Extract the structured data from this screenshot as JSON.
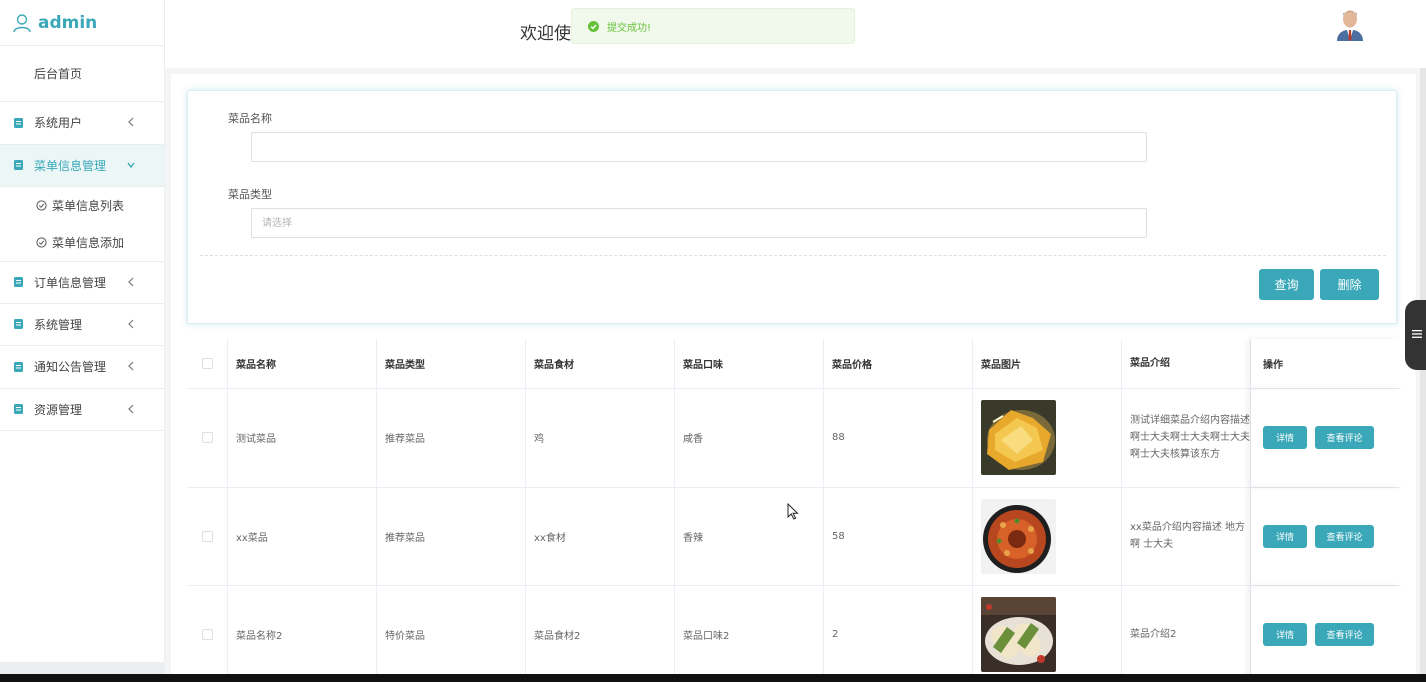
{
  "brand": {
    "title": "admin"
  },
  "sidebar": {
    "home": "后台首页",
    "items": [
      {
        "label": "系统用户"
      },
      {
        "label": "菜单信息管理"
      },
      {
        "label": "订单信息管理"
      },
      {
        "label": "系统管理"
      },
      {
        "label": "通知公告管理"
      },
      {
        "label": "资源管理"
      }
    ],
    "submenu": [
      {
        "label": "菜单信息列表"
      },
      {
        "label": "菜单信息添加"
      }
    ]
  },
  "header": {
    "welcome": "欢迎使"
  },
  "toast": {
    "message": "提交成功!"
  },
  "search": {
    "name_label": "菜品名称",
    "name_value": "",
    "type_label": "菜品类型",
    "type_placeholder": "请选择",
    "query_button": "查询",
    "delete_button": "删除"
  },
  "table": {
    "headers": [
      "菜品名称",
      "菜品类型",
      "菜品食材",
      "菜品口味",
      "菜品价格",
      "菜品图片",
      "菜品介绍",
      "操作"
    ],
    "rows": [
      {
        "name": "测试菜品",
        "type": "推荐菜品",
        "ingredient": "鸡",
        "taste": "咸香",
        "price": "88",
        "intro": "测试详细菜品介绍内容描述 啊士大夫啊士大夫啊士大夫 啊士大夫核算该东方"
      },
      {
        "name": "xx菜品",
        "type": "推荐菜品",
        "ingredient": "xx食材",
        "taste": "香辣",
        "price": "58",
        "intro": "xx菜品介绍内容描述 地方啊 士大夫"
      },
      {
        "name": "菜品名称2",
        "type": "特价菜品",
        "ingredient": "菜品食材2",
        "taste": "菜品口味2",
        "price": "2",
        "intro": "菜品介绍2"
      }
    ],
    "detail_button": "详情",
    "comment_button": "查看评论"
  },
  "colors": {
    "accent": "#3aa8b8",
    "success": "#67c23a",
    "toast_bg": "#f0f9eb"
  }
}
